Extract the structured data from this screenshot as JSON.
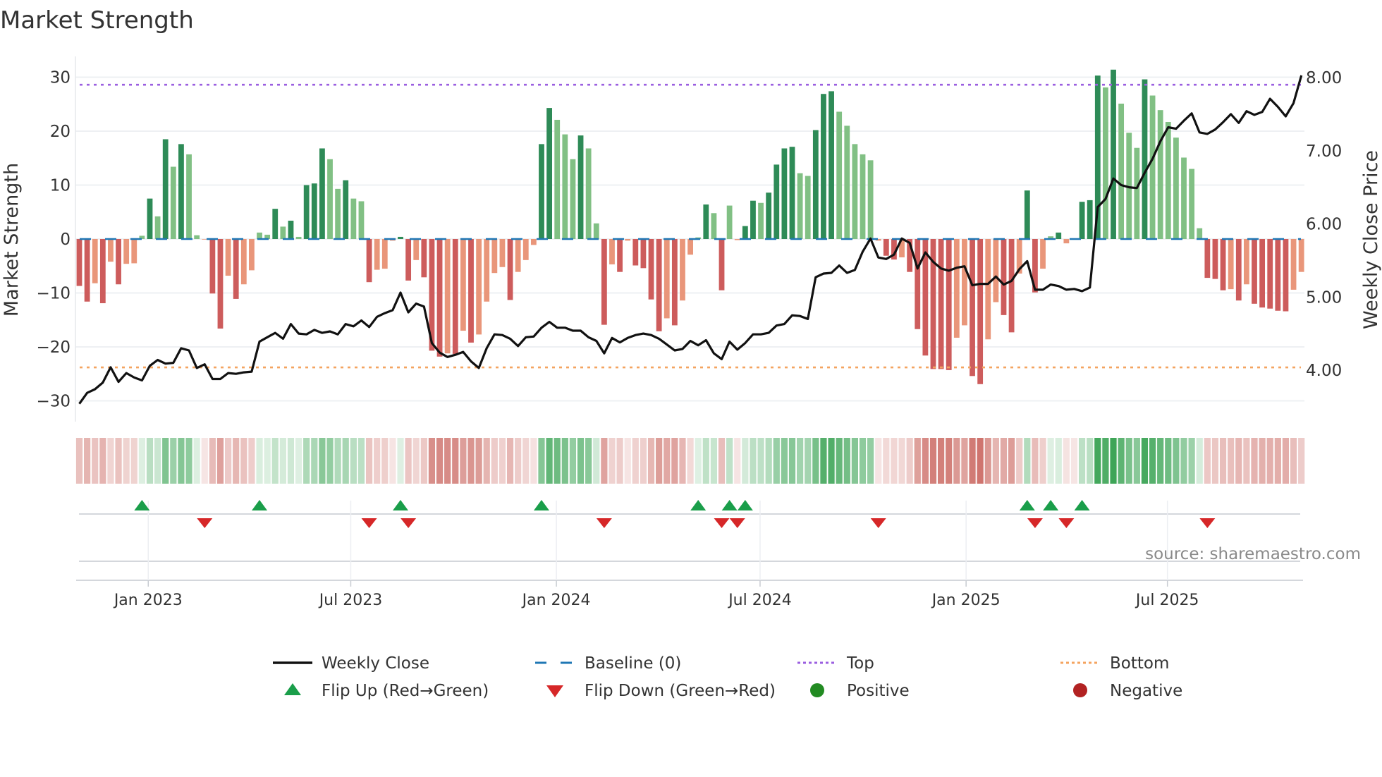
{
  "chart_data": {
    "type": "bar",
    "title": "Market Strength",
    "ylabel": "Market Strength",
    "y2label": "Weekly Close Price",
    "ylim": [
      -33,
      33
    ],
    "y2lim": [
      3.35,
      8.3
    ],
    "yticks": [
      30,
      20,
      10,
      0,
      -10,
      -20,
      -30
    ],
    "yticklabels": [
      "30",
      "20",
      "10",
      "0",
      "−10",
      "−20",
      "−30"
    ],
    "y2ticks": [
      8,
      7,
      6,
      5,
      4
    ],
    "y2ticklabels": [
      "8.00",
      "7.00",
      "6.00",
      "5.00",
      "4.00"
    ],
    "xticks": [
      {
        "week": 8.8,
        "label": "Jan 2023"
      },
      {
        "week": 34.65,
        "label": "Jul 2023"
      },
      {
        "week": 60.9,
        "label": "Jan 2024"
      },
      {
        "week": 86.9,
        "label": "Jul 2024"
      },
      {
        "week": 113.2,
        "label": "Jan 2025"
      },
      {
        "week": 138.9,
        "label": "Jul 2025"
      }
    ],
    "top_level": 28.6,
    "bottom_level": -23.8,
    "baseline": 0,
    "strength": [
      -8.7,
      -11.6,
      -8.2,
      -11.9,
      -4.2,
      -8.4,
      -4.6,
      -4.5,
      0.6,
      7.5,
      4.2,
      18.5,
      13.4,
      17.6,
      15.7,
      0.7,
      -0.1,
      -10.1,
      -16.6,
      -6.8,
      -11.1,
      -8.4,
      -5.8,
      1.2,
      0.8,
      5.6,
      2.3,
      3.4,
      0.4,
      10.0,
      10.3,
      16.8,
      14.8,
      9.3,
      10.9,
      7.5,
      7.0,
      -8.0,
      -5.7,
      -5.5,
      -0.3,
      0.4,
      -7.7,
      -3.9,
      -7.1,
      -20.7,
      -21.8,
      -21.2,
      -21.3,
      -17.0,
      -19.2,
      -17.7,
      -11.6,
      -6.3,
      -5.2,
      -11.3,
      -6.1,
      -3.9,
      -1.1,
      17.6,
      24.3,
      22.1,
      19.4,
      14.8,
      19.2,
      16.8,
      2.9,
      -15.9,
      -4.7,
      -6.1,
      -0.3,
      -4.9,
      -5.4,
      -11.2,
      -17.1,
      -14.7,
      -16.0,
      -11.4,
      -2.9,
      0.3,
      6.4,
      4.8,
      -9.5,
      6.2,
      -0.2,
      2.4,
      7.1,
      6.7,
      8.6,
      13.8,
      16.8,
      17.1,
      12.2,
      11.7,
      20.2,
      26.9,
      27.4,
      23.6,
      21.0,
      17.6,
      15.7,
      14.6,
      -0.3,
      -3.1,
      -3.8,
      -3.4,
      -6.1,
      -16.7,
      -21.6,
      -24.1,
      -24.1,
      -24.3,
      -18.3,
      -16.0,
      -25.4,
      -26.9,
      -18.6,
      -11.7,
      -14.1,
      -17.3,
      -6.4,
      9.0,
      -9.9,
      -5.5,
      0.5,
      1.2,
      -0.8,
      -0.1,
      6.9,
      7.2,
      30.3,
      28.1,
      31.4,
      25.1,
      19.7,
      16.9,
      29.6,
      26.6,
      23.9,
      21.7,
      18.8,
      15.1,
      13.0,
      2.0,
      -7.2,
      -7.4,
      -9.5,
      -9.3,
      -11.4,
      -8.4,
      -12.0,
      -12.7,
      -12.9,
      -13.3,
      -13.4,
      -9.4,
      -6.1
    ],
    "weekly_close": [
      3.54,
      3.69,
      3.74,
      3.83,
      4.04,
      3.84,
      3.96,
      3.9,
      3.86,
      4.06,
      4.14,
      4.09,
      4.1,
      4.3,
      4.27,
      4.03,
      4.08,
      3.88,
      3.88,
      3.96,
      3.95,
      3.97,
      3.98,
      4.39,
      4.45,
      4.51,
      4.43,
      4.63,
      4.5,
      4.49,
      4.55,
      4.51,
      4.53,
      4.49,
      4.63,
      4.6,
      4.68,
      4.59,
      4.73,
      4.78,
      4.82,
      5.06,
      4.79,
      4.91,
      4.87,
      4.37,
      4.24,
      4.18,
      4.21,
      4.25,
      4.12,
      4.03,
      4.3,
      4.49,
      4.48,
      4.43,
      4.33,
      4.45,
      4.46,
      4.58,
      4.66,
      4.58,
      4.58,
      4.54,
      4.54,
      4.45,
      4.4,
      4.23,
      4.44,
      4.38,
      4.44,
      4.48,
      4.5,
      4.48,
      4.43,
      4.35,
      4.27,
      4.29,
      4.4,
      4.34,
      4.41,
      4.23,
      4.15,
      4.39,
      4.28,
      4.37,
      4.49,
      4.49,
      4.51,
      4.61,
      4.63,
      4.75,
      4.74,
      4.7,
      5.27,
      5.32,
      5.33,
      5.43,
      5.33,
      5.37,
      5.62,
      5.8,
      5.54,
      5.52,
      5.58,
      5.8,
      5.74,
      5.39,
      5.61,
      5.48,
      5.39,
      5.36,
      5.4,
      5.42,
      5.16,
      5.18,
      5.18,
      5.28,
      5.17,
      5.22,
      5.38,
      5.49,
      5.1,
      5.1,
      5.17,
      5.15,
      5.1,
      5.11,
      5.08,
      5.13,
      6.23,
      6.34,
      6.62,
      6.53,
      6.5,
      6.49,
      6.7,
      6.89,
      7.13,
      7.32,
      7.3,
      7.41,
      7.51,
      7.25,
      7.23,
      7.29,
      7.39,
      7.5,
      7.38,
      7.54,
      7.49,
      7.53,
      7.71,
      7.6,
      7.47,
      7.65,
      8.03
    ],
    "flip_up_weeks": [
      8,
      23,
      41,
      59,
      79,
      83,
      85,
      121,
      124,
      128
    ],
    "flip_down_weeks": [
      16,
      37,
      42,
      67,
      82,
      84,
      102,
      122,
      126,
      144
    ],
    "legend": {
      "placement": "bottom",
      "items": [
        {
          "key": "weekly_close",
          "label": "Weekly Close"
        },
        {
          "key": "baseline",
          "label": "Baseline (0)"
        },
        {
          "key": "top",
          "label": "Top"
        },
        {
          "key": "bottom",
          "label": "Bottom"
        },
        {
          "key": "flip_up",
          "label": "Flip Up (Red→Green)"
        },
        {
          "key": "flip_down",
          "label": "Flip Down (Green→Red)"
        },
        {
          "key": "positive",
          "label": "Positive"
        },
        {
          "key": "negative",
          "label": "Negative"
        }
      ]
    },
    "annotation": "source: sharemaestro.com",
    "colors": {
      "pos_strong": "#2e8b57",
      "pos_weak": "#81c084",
      "neg_strong": "#cd5c5c",
      "neg_weak": "#e9967a",
      "baseline": "#1f77b4",
      "top": "#9b5fe0",
      "bottom": "#f4a460",
      "line": "#111111",
      "flip_up": "#1a9e4a",
      "flip_down": "#d62728",
      "positive": "#228b22",
      "negative": "#b22222",
      "strip_pos": "#2f9e4a",
      "strip_neg": "#c4564e"
    }
  }
}
